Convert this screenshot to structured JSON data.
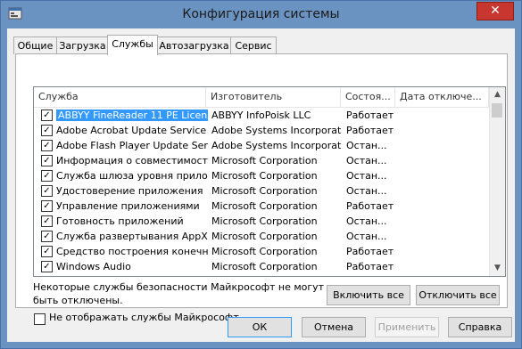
{
  "window": {
    "title": "Конфигурация системы",
    "close_label": "✕"
  },
  "tabs": [
    {
      "label": "Общие"
    },
    {
      "label": "Загрузка"
    },
    {
      "label": "Службы"
    },
    {
      "label": "Автозагрузка"
    },
    {
      "label": "Сервис"
    }
  ],
  "table": {
    "columns": [
      "Служба",
      "Изготовитель",
      "Состоя...",
      "Дата отключе..."
    ],
    "rows": [
      {
        "name": "ABBYY FineReader 11 PE Licensi...",
        "vendor": "ABBYY InfoPoisk LLC",
        "status": "Работает",
        "date": ""
      },
      {
        "name": "Adobe Acrobat Update Service",
        "vendor": "Adobe Systems Incorporated",
        "status": "Работает",
        "date": ""
      },
      {
        "name": "Adobe Flash Player Update Service",
        "vendor": "Adobe Systems Incorporated",
        "status": "Остан...",
        "date": ""
      },
      {
        "name": "Информация о совместимости ...",
        "vendor": "Microsoft Corporation",
        "status": "Остан...",
        "date": ""
      },
      {
        "name": "Служба шлюза уровня прилож...",
        "vendor": "Microsoft Corporation",
        "status": "Остан...",
        "date": ""
      },
      {
        "name": "Удостоверение приложения",
        "vendor": "Microsoft Corporation",
        "status": "Остан...",
        "date": ""
      },
      {
        "name": "Управление приложениями",
        "vendor": "Microsoft Corporation",
        "status": "Работает",
        "date": ""
      },
      {
        "name": "Готовность приложений",
        "vendor": "Microsoft Corporation",
        "status": "Остан...",
        "date": ""
      },
      {
        "name": "Служба развертывания AppX (...",
        "vendor": "Microsoft Corporation",
        "status": "Остан...",
        "date": ""
      },
      {
        "name": "Средство построения конечн...",
        "vendor": "Microsoft Corporation",
        "status": "Работает",
        "date": ""
      },
      {
        "name": "Windows Audio",
        "vendor": "Microsoft Corporation",
        "status": "Работает",
        "date": ""
      }
    ]
  },
  "checkbox_checked_glyph": "✓",
  "note": "Некоторые службы безопасности Майкрософт не могут быть отключены.",
  "buttons": {
    "enable_all": "Включить все",
    "disable_all": "Отключить все",
    "ok": "ОК",
    "cancel": "Отмена",
    "apply": "Применить",
    "help": "Справка"
  },
  "hide_ms_label": "Не отображать службы Майкрософт",
  "scroll": {
    "up": "▲",
    "down": "▼"
  }
}
